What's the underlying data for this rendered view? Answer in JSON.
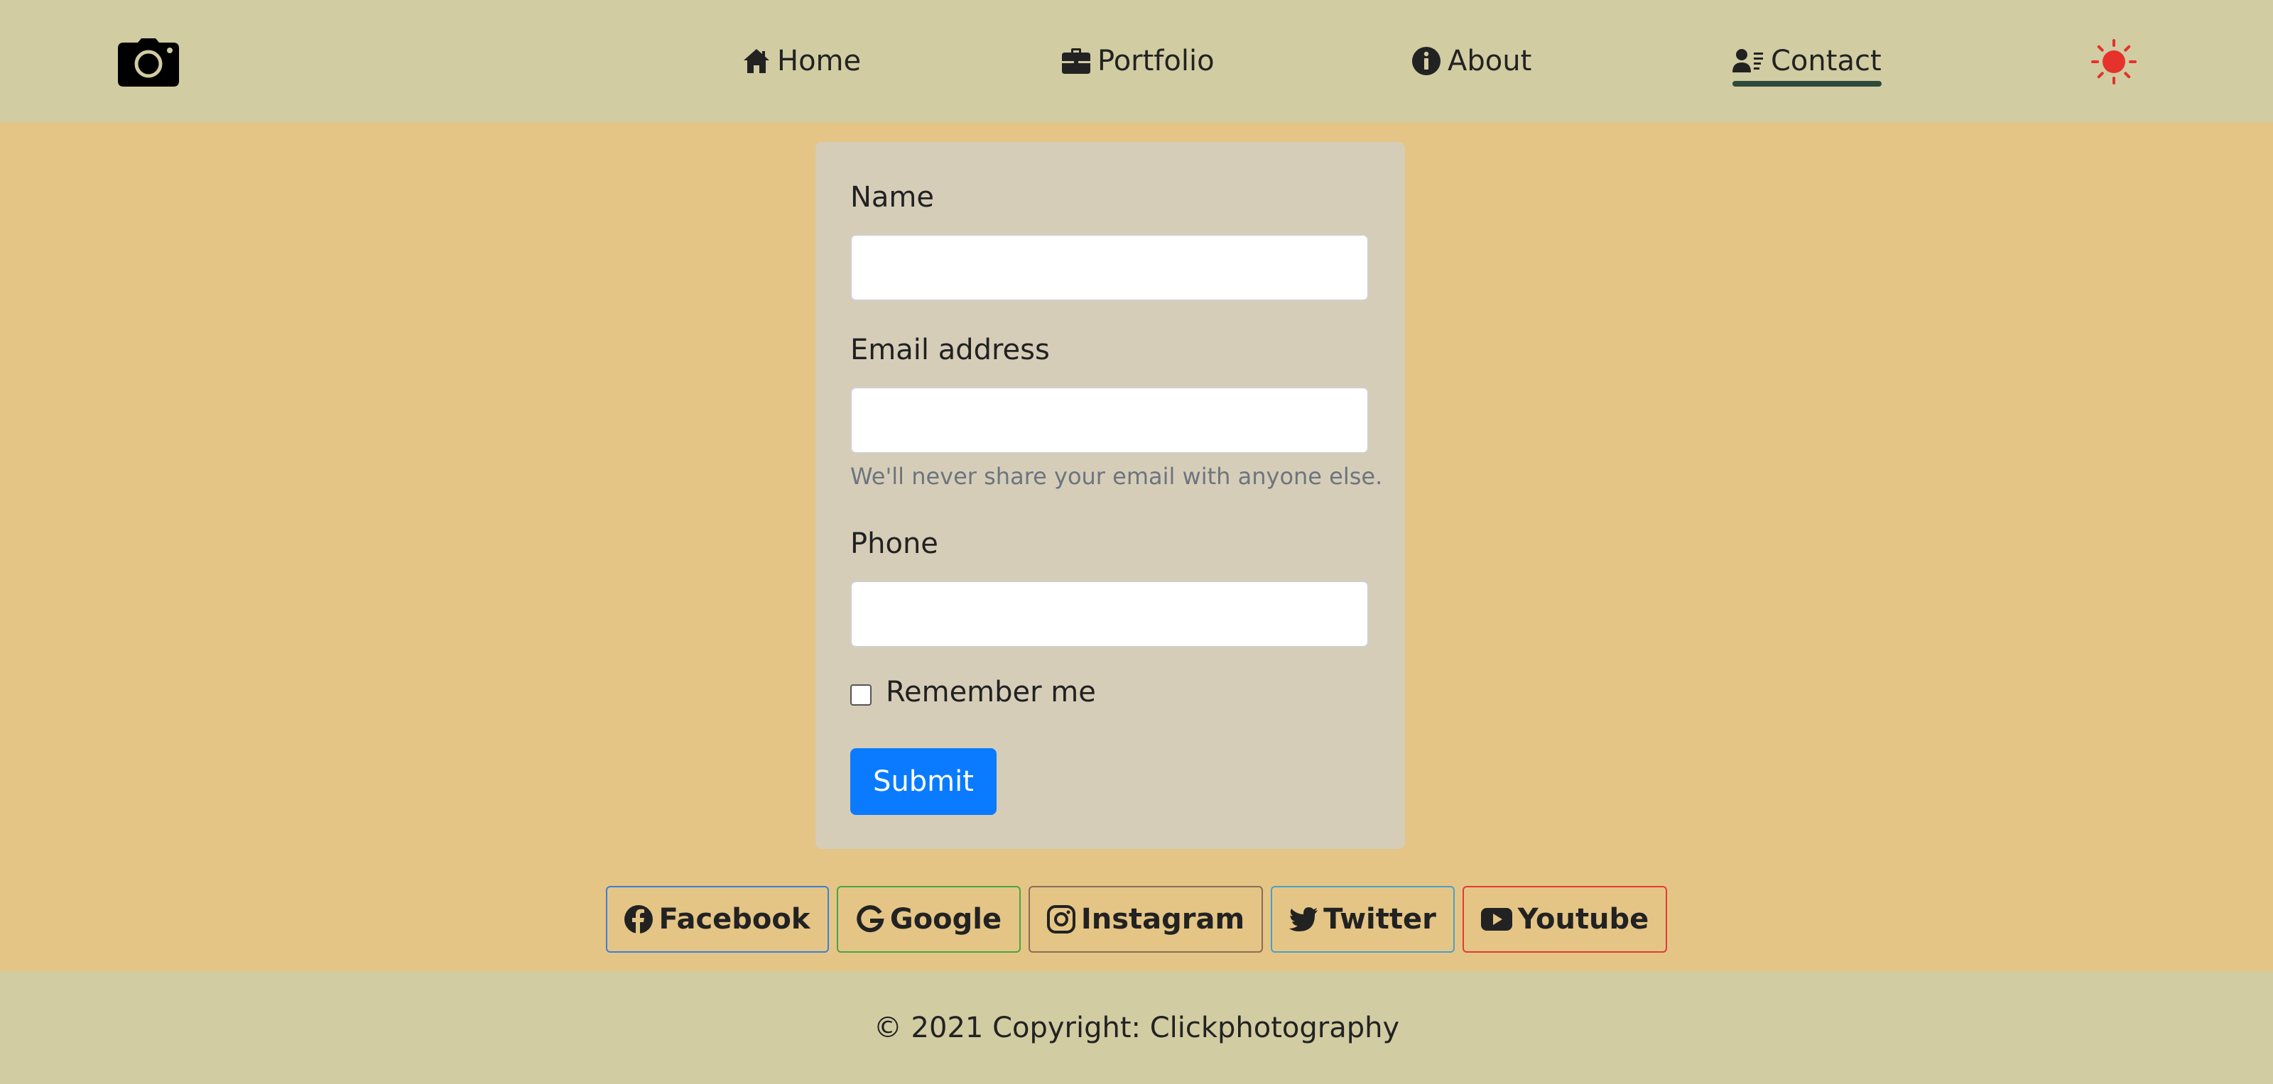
{
  "colors": {
    "navbar_bg": "#d1cca2",
    "page_bg": "#e4c586",
    "card_bg": "#d6cdb9",
    "primary": "#0a7bfe",
    "theme_icon": "#e5322b",
    "active_underline": "#2e4a3a"
  },
  "navbar": {
    "brand_icon": "camera-icon",
    "items": [
      {
        "label": "Home",
        "icon": "home-icon"
      },
      {
        "label": "Portfolio",
        "icon": "briefcase-icon"
      },
      {
        "label": "About",
        "icon": "info-icon"
      },
      {
        "label": "Contact",
        "icon": "contact-card-icon",
        "active": true
      }
    ],
    "theme_toggle_icon": "sun-icon"
  },
  "form": {
    "name_label": "Name",
    "name_value": "",
    "email_label": "Email address",
    "email_value": "",
    "email_help": "We'll never share your email with anyone else.",
    "phone_label": "Phone",
    "phone_value": "",
    "remember_label": "Remember me",
    "remember_checked": false,
    "submit_label": "Submit"
  },
  "social": [
    {
      "label": "Facebook",
      "icon": "facebook-icon",
      "border": "#3f7ed6"
    },
    {
      "label": "Google",
      "icon": "google-icon",
      "border": "#4ba24b"
    },
    {
      "label": "Instagram",
      "icon": "instagram-icon",
      "border": "#8a6d58"
    },
    {
      "label": "Twitter",
      "icon": "twitter-icon",
      "border": "#4a9fc9"
    },
    {
      "label": "Youtube",
      "icon": "youtube-icon",
      "border": "#e33a3a"
    }
  ],
  "footer": {
    "copyright": "© 2021 Copyright: Clickphotography"
  }
}
